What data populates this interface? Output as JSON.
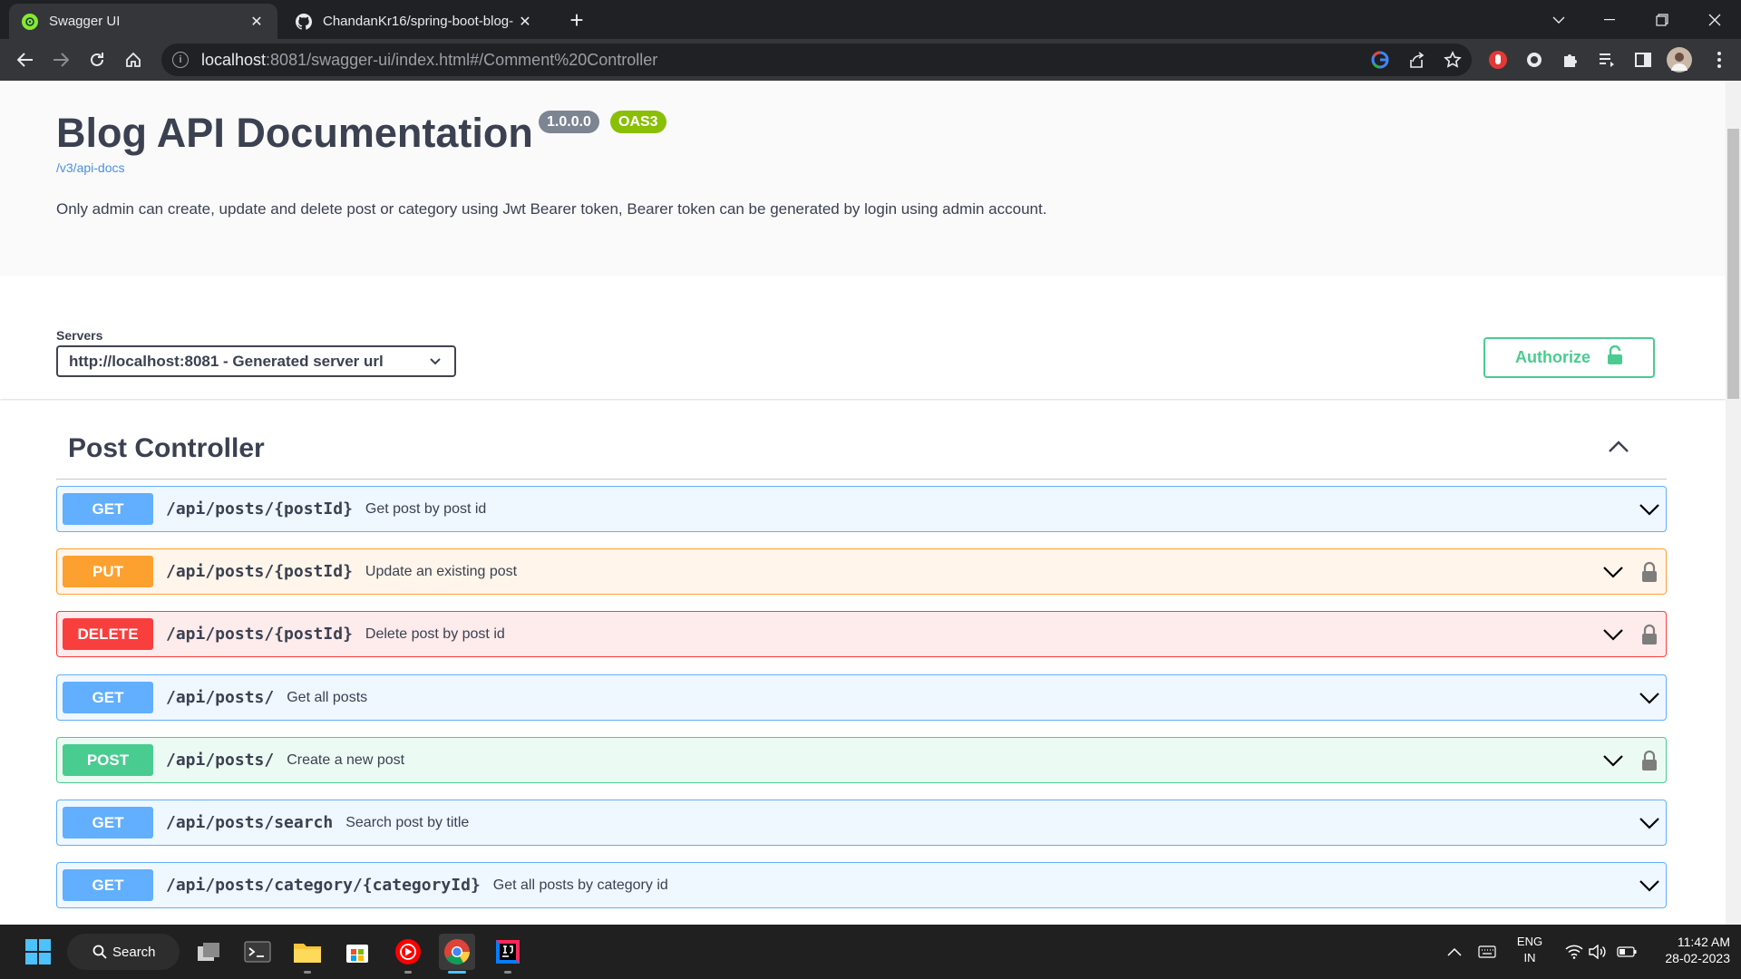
{
  "browser": {
    "tabs": [
      {
        "title": "Swagger UI",
        "icon": "swagger-favicon",
        "active": true
      },
      {
        "title": "ChandanKr16/spring-boot-blog-",
        "icon": "github-favicon",
        "active": false
      }
    ],
    "url_host": "localhost",
    "url_rest": ":8081/swagger-ui/index.html#/Comment%20Controller"
  },
  "info": {
    "title": "Blog API Documentation",
    "version": "1.0.0.0",
    "spec": "OAS3",
    "link": "/v3/api-docs",
    "description": "Only admin can create, update and delete post or category using Jwt Bearer token, Bearer token can be generated by login using admin account."
  },
  "servers": {
    "label": "Servers",
    "selected": "http://localhost:8081 - Generated server url"
  },
  "authorize_label": "Authorize",
  "tag": {
    "name": "Post Controller",
    "operations": [
      {
        "method": "GET",
        "path": "/api/posts/{postId}",
        "summary": "Get post by post id",
        "locked": false
      },
      {
        "method": "PUT",
        "path": "/api/posts/{postId}",
        "summary": "Update an existing post",
        "locked": true
      },
      {
        "method": "DELETE",
        "path": "/api/posts/{postId}",
        "summary": "Delete post by post id",
        "locked": true
      },
      {
        "method": "GET",
        "path": "/api/posts/",
        "summary": "Get all posts",
        "locked": false
      },
      {
        "method": "POST",
        "path": "/api/posts/",
        "summary": "Create a new post",
        "locked": true
      },
      {
        "method": "GET",
        "path": "/api/posts/search",
        "summary": "Search post by title",
        "locked": false
      },
      {
        "method": "GET",
        "path": "/api/posts/category/{categoryId}",
        "summary": "Get all posts by category id",
        "locked": false
      }
    ]
  },
  "taskbar": {
    "search_label": "Search",
    "language": "ENG",
    "region": "IN",
    "time": "11:42 AM",
    "date": "28-02-2023"
  },
  "colors": {
    "get": "#61affe",
    "put": "#fca130",
    "delete": "#f93e3e",
    "post": "#49cc90",
    "oas_badge": "#89bf04",
    "version_badge": "#7d8492"
  }
}
